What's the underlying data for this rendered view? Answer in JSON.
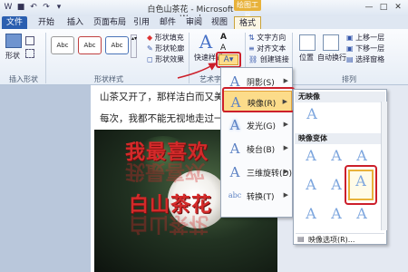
{
  "window": {
    "title": "白色山茶花 - Microsoft Word",
    "context_tab_header": "绘图工具"
  },
  "tabs": [
    "文件",
    "开始",
    "插入",
    "页面布局",
    "引用",
    "邮件",
    "审阅",
    "视图",
    "格式"
  ],
  "ribbon": {
    "shape_button_label": "形状",
    "insert_shapes_label": "插入形状",
    "shape_styles_label": "形状样式",
    "shape_style_samples": [
      "Abc",
      "Abc",
      "Abc"
    ],
    "shape_fill_label": "形状填充",
    "shape_outline_label": "形状轮廓",
    "shape_effects_label": "形状效果",
    "quick_styles_label": "快速样式",
    "wordart_styles_label": "艺术字样式",
    "text_direction_label": "文字方向",
    "align_text_label": "对齐文本",
    "create_link_label": "创建链接",
    "position_label": "位置",
    "wrap_text_label": "自动换行",
    "bring_forward_label": "上移一层",
    "send_backward_label": "下移一层",
    "selection_pane_label": "选择窗格",
    "arrange_label": "排列"
  },
  "document": {
    "line1": "山茶又开了，那样洁白而又美",
    "line2": "每次，我都不能无视地走过一",
    "wordart_line1": "我最喜欢",
    "wordart_line2": "白山茶花"
  },
  "effects_menu": {
    "items": [
      {
        "label": "阴影(S)",
        "glyph": "A"
      },
      {
        "label": "映像(R)",
        "glyph": "A"
      },
      {
        "label": "发光(G)",
        "glyph": "A"
      },
      {
        "label": "棱台(B)",
        "glyph": "A"
      },
      {
        "label": "三维旋转(D)",
        "glyph": "A"
      },
      {
        "label": "转换(T)",
        "glyph": "abc"
      }
    ],
    "arrow": "▶"
  },
  "reflection_submenu": {
    "no_reflection_header": "无映像",
    "variants_header": "映像变体",
    "options_label": "映像选项(R)...",
    "glyph": "A"
  },
  "colors": {
    "accent": "#2b5fb0",
    "highlight": "#fcdc8a",
    "callout_red": "#cc1f2a",
    "wordart_red": "#d42a2a"
  }
}
